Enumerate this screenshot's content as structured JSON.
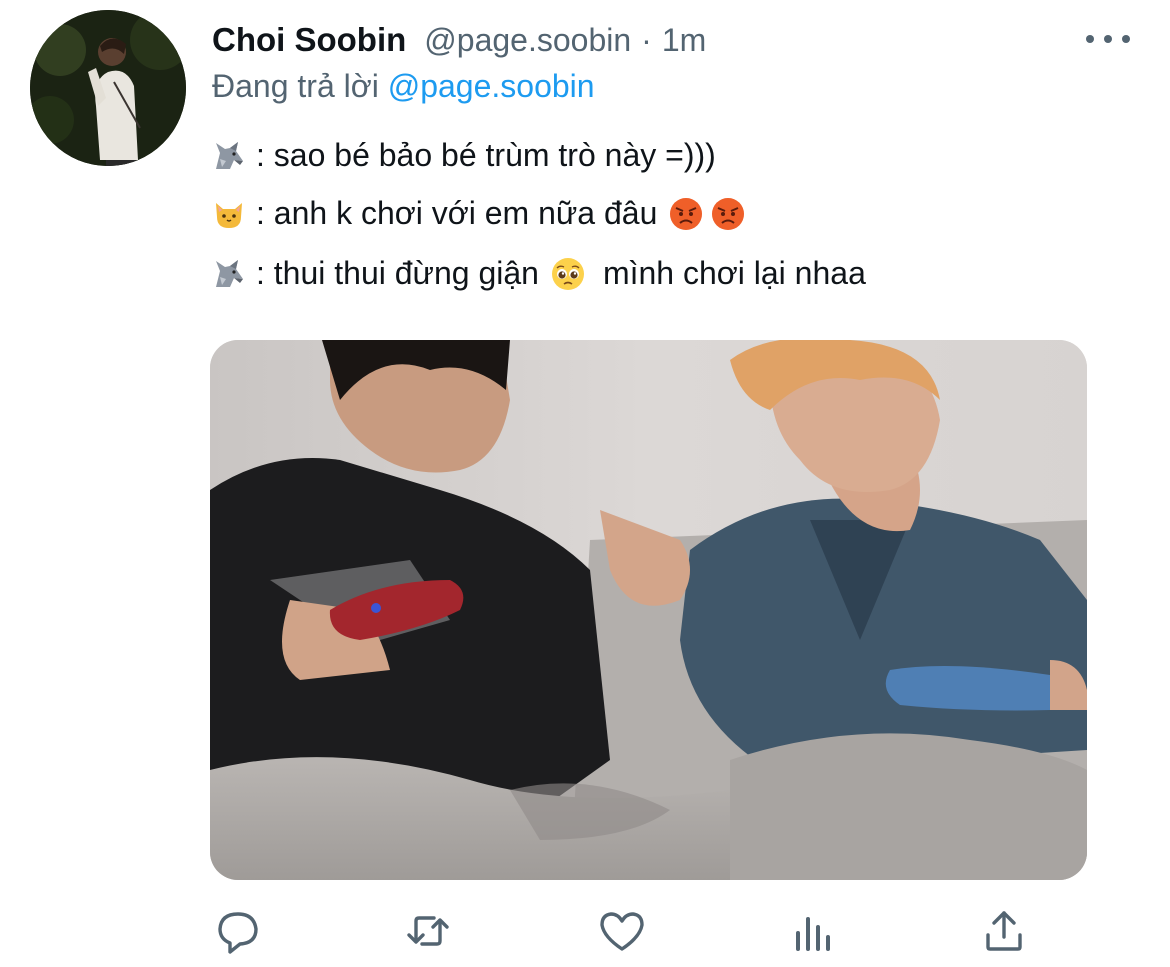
{
  "tweet": {
    "display_name": "Choi Soobin",
    "handle": "@page.soobin",
    "separator": "·",
    "time": "1m",
    "reply_prefix": "Đang trả lời ",
    "reply_mention": "@page.soobin",
    "lines": [
      {
        "icon": "wolf-emoji",
        "text": ": sao bé bảo bé trùm trò này =)))"
      },
      {
        "icon": "cat-emoji",
        "text": ": anh k chơi với em nữa đâu",
        "trailing_icons": [
          "angry-face-emoji",
          "angry-face-emoji"
        ]
      },
      {
        "icon": "wolf-emoji",
        "text": ": thui thui đừng giận",
        "mid_icon": "pleading-face-emoji",
        "text_after": "mình chơi lại nhaa"
      }
    ],
    "media": {
      "kind": "photo",
      "icon": "photo-two-people-gaming"
    }
  },
  "actions": [
    {
      "name": "reply",
      "icon": "reply-bubble-icon"
    },
    {
      "name": "retweet",
      "icon": "retweet-arrows-icon"
    },
    {
      "name": "like",
      "icon": "heart-icon"
    },
    {
      "name": "analytics",
      "icon": "bar-chart-icon"
    },
    {
      "name": "share",
      "icon": "share-upload-icon"
    }
  ],
  "colors": {
    "text": "#0f1419",
    "secondary": "#536471",
    "link": "#1d9bf0"
  }
}
